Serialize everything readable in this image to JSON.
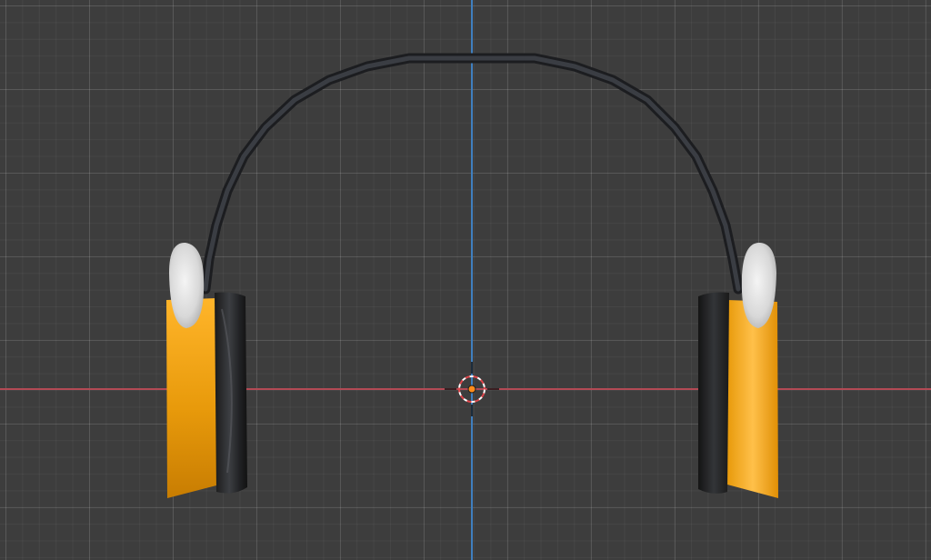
{
  "viewport": {
    "label": "3D viewport",
    "background": "#3d3d3d",
    "x_axis_color": "#b34a55",
    "y_axis_color": "#3f7fbf"
  },
  "scene": {
    "object": "headphones",
    "ear_cup_color": "#e79a08",
    "cushion_color": "#232323",
    "headband_color": "#2c2e33",
    "slider_color": "#e6e6e6"
  },
  "cursor": {
    "icon": "3d-cursor-icon",
    "origin_color": "#ff8c1a"
  }
}
